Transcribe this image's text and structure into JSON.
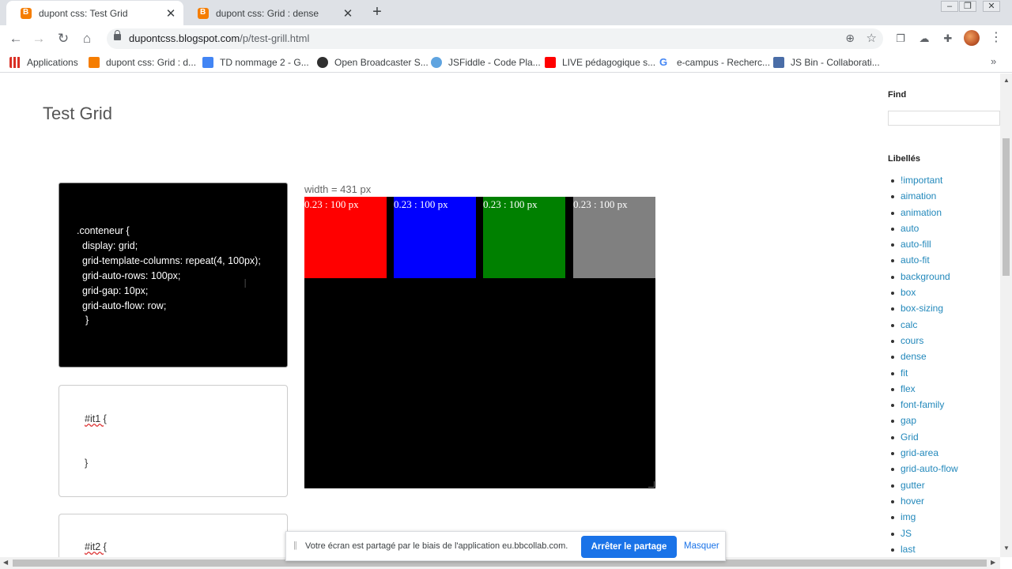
{
  "browser": {
    "tabs": [
      {
        "title": "dupont css: Test Grid",
        "active": true
      },
      {
        "title": "dupont css: Grid : dense",
        "active": false
      }
    ],
    "url_host": "dupontcss.blogspot.com",
    "url_path": "/p/test-grill.html",
    "bookmarks": [
      {
        "label": "Applications",
        "icon": "apps-grid-icon",
        "color": "#d93025"
      },
      {
        "label": "dupont css: Grid : d...",
        "icon": "blogger-icon",
        "color": "#f57d00"
      },
      {
        "label": "TD nommage 2 - G...",
        "icon": "docs-icon",
        "color": "#4285f4"
      },
      {
        "label": "Open Broadcaster S...",
        "icon": "obs-icon",
        "color": "#303030"
      },
      {
        "label": "JSFiddle - Code Pla...",
        "icon": "jsfiddle-icon",
        "color": "#5fa4e0"
      },
      {
        "label": "LIVE pédagogique s...",
        "icon": "youtube-icon",
        "color": "#ff0000"
      },
      {
        "label": "e-campus - Recherc...",
        "icon": "google-icon",
        "color": "#4285f4"
      },
      {
        "label": "JS Bin - Collaborati...",
        "icon": "jsbin-icon",
        "color": "#4a6da7"
      }
    ]
  },
  "page": {
    "title": "Test Grid",
    "css_rule": [
      ".conteneur {",
      "display: grid;",
      "grid-template-columns: repeat(4, 100px);",
      "grid-auto-rows: 100px;",
      "grid-gap: 10px;",
      "grid-auto-flow: row;",
      "}"
    ],
    "item_rules": [
      {
        "selector": "#it1 {",
        "close": "}"
      },
      {
        "selector": "#it2 {",
        "close": ""
      }
    ],
    "width_label": "width = 431 px",
    "grid_items": [
      {
        "text": "0.23 : 100 px",
        "color": "#ff0000"
      },
      {
        "text": "0.23 : 100 px",
        "color": "#0000ff"
      },
      {
        "text": "0.23 : 100 px",
        "color": "#008000"
      },
      {
        "text": "0.23 : 100 px",
        "color": "#808080"
      }
    ]
  },
  "sidebar": {
    "find_heading": "Find",
    "labels_heading": "Libellés",
    "labels": [
      "!important",
      "aimation",
      "animation",
      "auto",
      "auto-fill",
      "auto-fit",
      "background",
      "box",
      "box-sizing",
      "calc",
      "cours",
      "dense",
      "fit",
      "flex",
      "font-family",
      "gap",
      "Grid",
      "grid-area",
      "grid-auto-flow",
      "gutter",
      "hover",
      "img",
      "JS",
      "last"
    ]
  },
  "share_bar": {
    "text": "Votre écran est partagé par le biais de l'application eu.bbcollab.com.",
    "stop_label": "Arrêter le partage",
    "hide_label": "Masquer"
  }
}
